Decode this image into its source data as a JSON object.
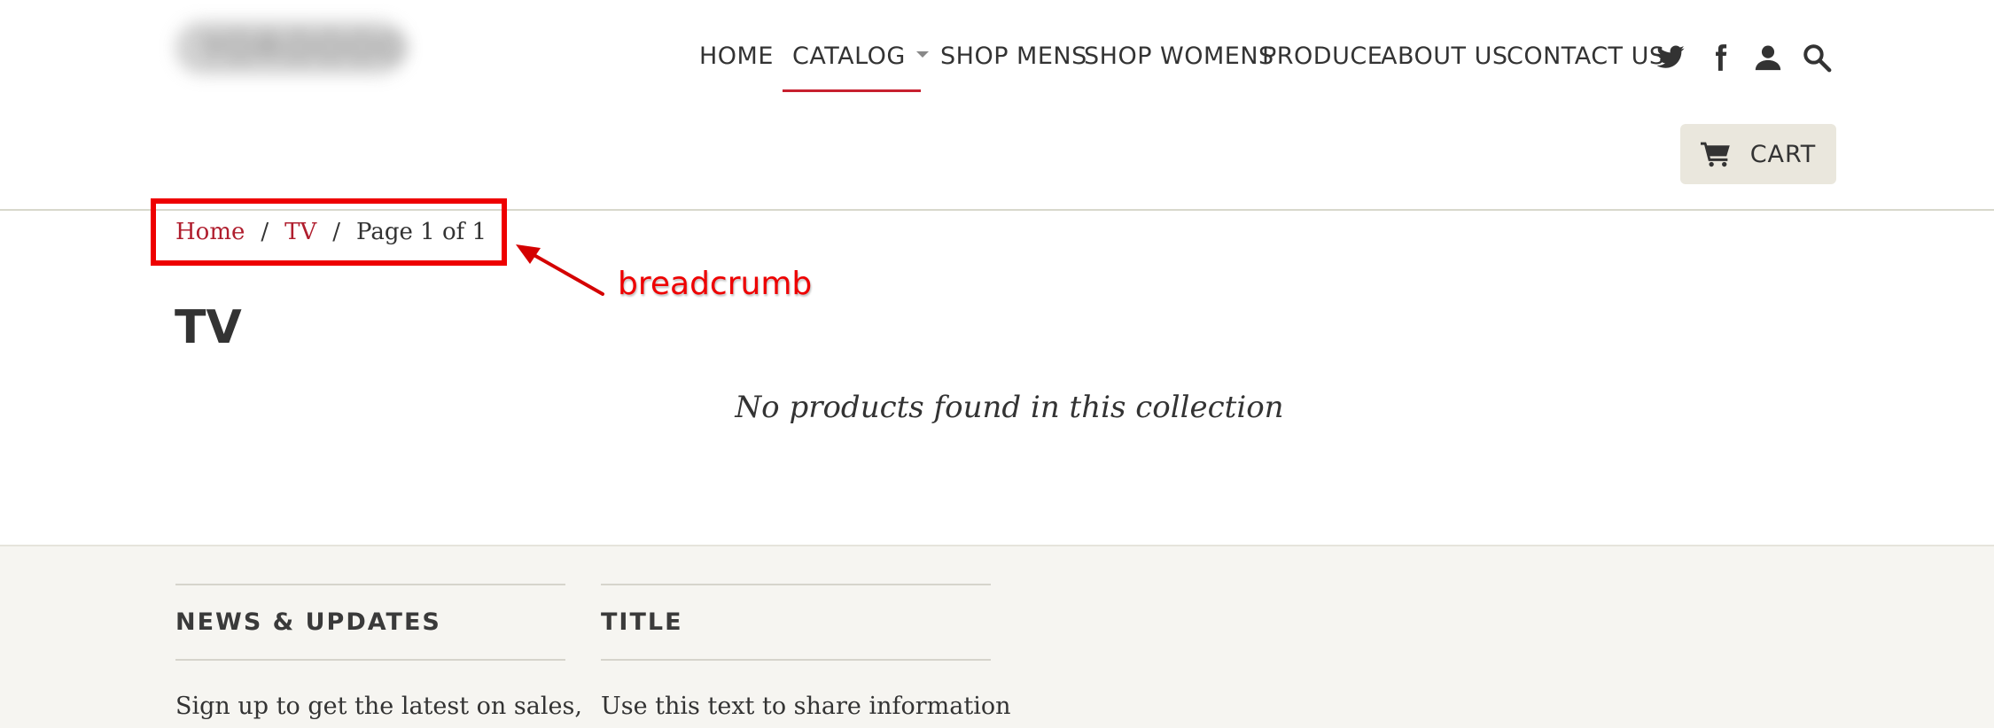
{
  "header": {
    "logo_text": "YOROOOO",
    "nav": [
      {
        "label": "HOME"
      },
      {
        "label": "CATALOG"
      },
      {
        "label": "SHOP MENS"
      },
      {
        "label": "SHOP WOMENS"
      },
      {
        "label": "PRODUCE"
      },
      {
        "label": "ABOUT US"
      },
      {
        "label": "CONTACT US"
      }
    ],
    "icons": [
      "twitter-icon",
      "facebook-icon",
      "account-icon",
      "search-icon"
    ],
    "cart_label": "CART"
  },
  "breadcrumb": {
    "home": "Home",
    "sep1": "/",
    "collection": "TV",
    "sep2": "/",
    "current": "Page 1 of 1"
  },
  "annotation": {
    "label": "breadcrumb"
  },
  "main": {
    "title": "TV",
    "empty_message": "No products found in this collection"
  },
  "footer": {
    "col1": {
      "heading": "NEWS & UPDATES",
      "text": "Sign up to get the latest on sales,"
    },
    "col2": {
      "heading": "TITLE",
      "text": "Use this text to share information"
    }
  },
  "colors": {
    "accent": "#b01e2e",
    "annotation": "#ee0000",
    "cart_bg": "#eae7dd",
    "footer_bg": "#f6f5f1"
  }
}
